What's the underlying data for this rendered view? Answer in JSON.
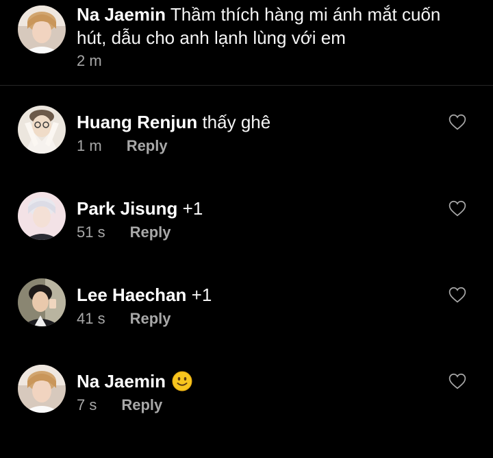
{
  "caption": {
    "username": "Na Jaemin",
    "text_line1": "Thầm thích hàng mi ánh mắt cuốn",
    "text_line2": "hút, dẫu cho anh lạnh lùng với em",
    "time": "2 m"
  },
  "comments": [
    {
      "username": "Huang Renjun",
      "text": "thấy ghê",
      "time": "1 m",
      "reply_label": "Reply"
    },
    {
      "username": "Park Jisung",
      "text": "+1",
      "time": "51 s",
      "reply_label": "Reply"
    },
    {
      "username": "Lee Haechan",
      "text": "+1",
      "time": "41 s",
      "reply_label": "Reply"
    },
    {
      "username": "Na Jaemin",
      "text": "",
      "emoji": "slightly-smiling-face",
      "time": "7 s",
      "reply_label": "Reply"
    }
  ],
  "colors": {
    "background": "#000000",
    "text": "#f5f5f5",
    "secondary": "#a8a8a8",
    "divider": "#262626",
    "emoji": "#f7c51e"
  }
}
